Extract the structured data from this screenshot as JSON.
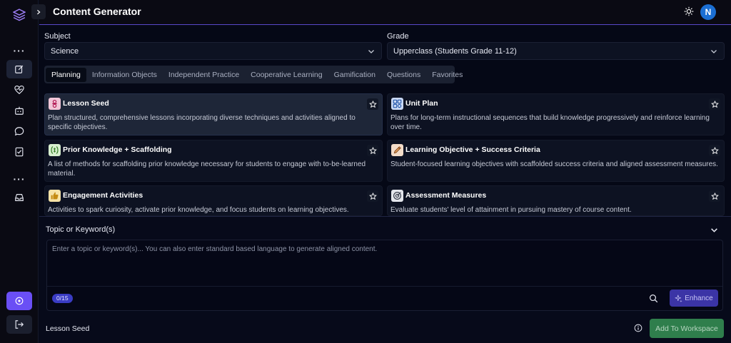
{
  "header": {
    "title": "Content Generator",
    "avatar_initial": "N"
  },
  "form": {
    "subject": {
      "label": "Subject",
      "value": "Science"
    },
    "grade": {
      "label": "Grade",
      "value": "Upperclass (Students Grade 11-12)"
    }
  },
  "tabs": [
    {
      "label": "Planning"
    },
    {
      "label": "Information Objects"
    },
    {
      "label": "Independent Practice"
    },
    {
      "label": "Cooperative Learning"
    },
    {
      "label": "Gamification"
    },
    {
      "label": "Questions"
    },
    {
      "label": "Favorites"
    }
  ],
  "cards": [
    {
      "title": "Lesson Seed",
      "desc": "Plan structured, comprehensive lessons incorporating diverse techniques and activities aligned to specific objectives.",
      "icon": "lesson-seed-icon"
    },
    {
      "title": "Unit Plan",
      "desc": "Plans for long-term instructional sequences that build knowledge progressively and reinforce learning over time.",
      "icon": "unit-plan-icon"
    },
    {
      "title": "Prior Knowledge + Scaffolding",
      "desc": "A list of methods for scaffolding prior knowledge necessary for students to engage with to-be-learned material.",
      "icon": "prior-knowledge-icon"
    },
    {
      "title": "Learning Objective + Success Criteria",
      "desc": "Student-focused learning objectives with scaffolded success criteria and aligned assessment measures.",
      "icon": "pencil-icon"
    },
    {
      "title": "Engagement Activities",
      "desc": "Activities to spark curiosity, activate prior knowledge, and focus students on learning objectives.",
      "icon": "thumbs-up-icon"
    },
    {
      "title": "Assessment Measures",
      "desc": "Evaluate students' level of attainment in pursuing mastery of course content.",
      "icon": "target-icon"
    }
  ],
  "topic": {
    "label": "Topic or Keyword(s)",
    "placeholder": "Enter a topic or keyword(s)... You can also enter standard based language to generate aligned content.",
    "counter": "0/15",
    "enhance_label": "Enhance"
  },
  "footer": {
    "selected": "Lesson Seed",
    "add_label": "Add To Workspace"
  },
  "colors": {
    "accent": "#6a4ff5",
    "add_button": "#2f7e4c",
    "avatar": "#1b6fd3"
  }
}
